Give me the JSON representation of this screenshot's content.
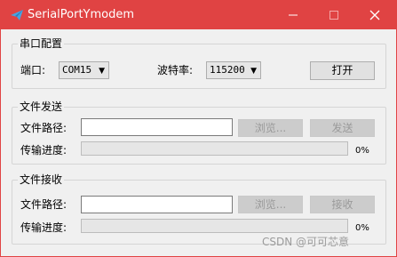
{
  "window": {
    "title": "SerialPortYmodem",
    "accent": "#e04343"
  },
  "icons": {
    "app": "send-plane-icon",
    "minimize": "minimize-icon",
    "maximize": "maximize-icon",
    "close": "close-icon",
    "dropdown": "chevron-down-icon"
  },
  "serial_config": {
    "title": "串口配置",
    "port_label": "端口:",
    "port_value": "COM15",
    "baud_label": "波特率:",
    "baud_value": "115200",
    "open_button": "打开"
  },
  "file_send": {
    "title": "文件发送",
    "path_label": "文件路径:",
    "path_value": "",
    "browse_button": "浏览...",
    "send_button": "发送",
    "progress_label": "传输进度:",
    "progress_value": 0,
    "progress_text": "0%"
  },
  "file_receive": {
    "title": "文件接收",
    "path_label": "文件路径:",
    "path_value": "",
    "browse_button": "浏览...",
    "receive_button": "接收",
    "progress_label": "传输进度:",
    "progress_value": 0,
    "progress_text": "0%"
  },
  "watermark": "CSDN @可可芯意"
}
